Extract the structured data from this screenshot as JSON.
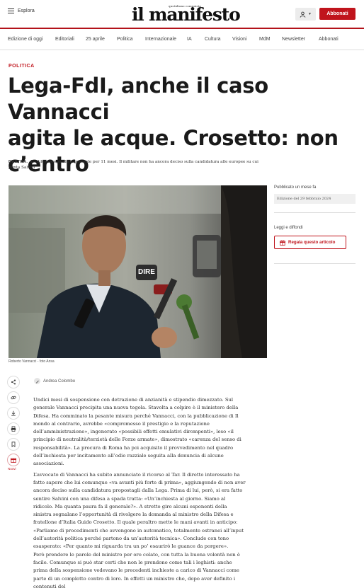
{
  "header": {
    "explore_label": "Esplora",
    "logo_tagline": "quotidiano comunista",
    "logo_name": "il manifesto",
    "subscribe_label": "Abbonati"
  },
  "nav": {
    "items": [
      "Edizione di oggi",
      "Editoriali",
      "25 aprile",
      "Politica",
      "Internazionale",
      "IA",
      "Cultura",
      "Visioni",
      "MdM",
      "Newsletter",
      "Abbonati"
    ]
  },
  "article": {
    "section": "POLITICA",
    "title_lines": [
      "Lega-FdI, anche il caso Vannacci",
      "agita le acque. Crosetto: non",
      "c’entro"
    ],
    "summary_kicker": "DESTRA.",
    "summary": "La difesa sospende il generale per 11 mesi. Il militare non ha ancora deciso sulla candidatura alle europee su cui punta Salvini",
    "photo_overlay_text": "DIRE",
    "photo_caption": "Roberto Vannacci - foto Ansa",
    "author": "Andrea Colombo",
    "body_paragraphs": [
      "Undici mesi di sospensione con detrazione di anzianità e stipendio dimezzato. Sul generale Vannacci precipita una nuova tegola. Stavolta a colpire è il ministero della Difesa. Ha comminato la pesante misura perché Vannacci, con la pubblicazione di Il mondo al contrario, avrebbe «compromesso il prestigio e la reputazione dell’amministrazione», ingenerato «possibili effetti emulativi dirompenti», leso «il principio di neutralità/terzietà delle Forze armate», dimostrato «carenza del senso di responsabilità». La procura di Roma ha poi acquisito il provvedimento nel quadro dell’inchiesta per incitamento all’odio razziale seguita alla denuncia di alcune associazioni.",
      "L’avvocato di Vannacci ha subito annunciato il ricorso al Tar. Il diretto interessato ha fatto sapere che lui comunque «va avanti più forte di prima», aggiungendo di non aver ancora deciso sulla candidatura propostagli dalla Lega. Prima di lui, però, si era fatto sentire Salvini con una difesa a spada tratta: «Un’inchiesta al giorno. Siamo al ridicolo. Ma quanta paura fa il generale?». A stretto giro alcuni esponenti della sinistra segnalano l’opportunità di rivolgere la domanda al ministro della Difesa e fratellone d’Italia Guido Crosetto. Il quale peraltro mette le mani avanti in anticipo: «Parliamo di procedimenti che avvengono in automatico, totalmente estranei all’input dell’autorità politica perché partono da un’autorità tecnica». Conclude con tono esasperato: «Per quanto mi riguarda tra un po’ esaurirò le guance da porgere».",
      "Però prendere le parole del ministro per oro colato, con tutta la buona volontà non è facile. Comunque si può star certi che non le prendono come tali i leghisti: anche prima della sospensione vedevano le precedenti inchieste a carico di Vannacci come parte di un complotto contro di loro. In effetti un ministro che, dopo aver definito i contenuti del"
    ]
  },
  "sidebar": {
    "published_label": "Pubblicato un mese fa",
    "edition_label": "Edizione del 29 febbraio 2024",
    "read_share_label": "Leggi e diffondi",
    "gift_label": "Regala questo articolo"
  },
  "share": {
    "icons": [
      "share-icon",
      "link-icon",
      "download-icon",
      "print-icon",
      "bookmark-icon",
      "gift-icon"
    ],
    "gift_caption": "Nuovi"
  },
  "colors": {
    "accent": "#c0141c"
  }
}
